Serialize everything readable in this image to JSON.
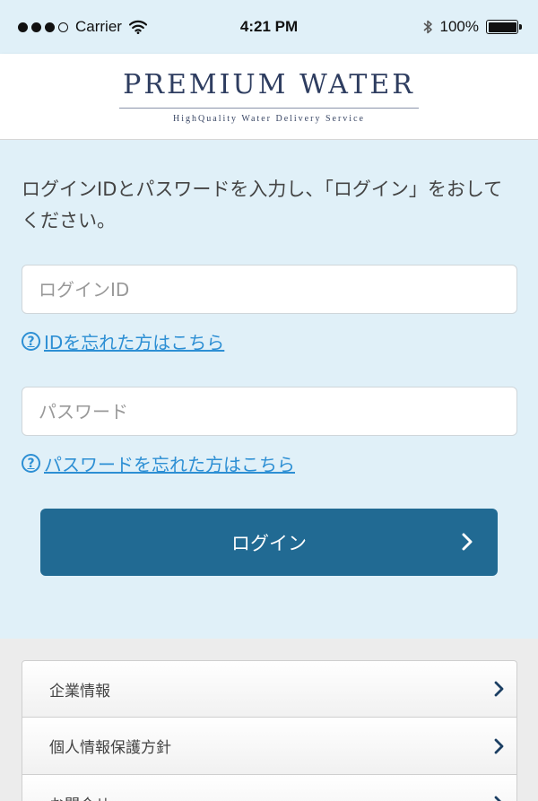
{
  "status_bar": {
    "carrier": "Carrier",
    "time": "4:21 PM",
    "battery": "100%"
  },
  "header": {
    "logo_title": "PREMIUM WATER",
    "logo_tagline": "HighQuality  Water  Delivery  Service"
  },
  "login": {
    "instruction": "ログインIDとパスワードを入力し、「ログイン」をおしてください。",
    "id_placeholder": "ログインID",
    "id_value": "",
    "forgot_id_link": "IDを忘れた方はこちら",
    "password_placeholder": "パスワード",
    "password_value": "",
    "forgot_password_link": "パスワードを忘れた方はこちら",
    "help_icon": "?",
    "button_label": "ログイン"
  },
  "footer_menu": {
    "items": [
      {
        "label": "企業情報"
      },
      {
        "label": "個人情報保護方針"
      },
      {
        "label": "お問合せ"
      }
    ]
  },
  "colors": {
    "background": "#e0f0f8",
    "brand_navy": "#2e3d60",
    "link_blue": "#2d8fd4",
    "button_blue": "#216a93",
    "chevron_navy": "#1c3f63"
  },
  "icons": [
    "signal-dots-icon",
    "wifi-icon",
    "bluetooth-icon",
    "battery-icon",
    "question-circle-icon",
    "chevron-right-icon"
  ]
}
